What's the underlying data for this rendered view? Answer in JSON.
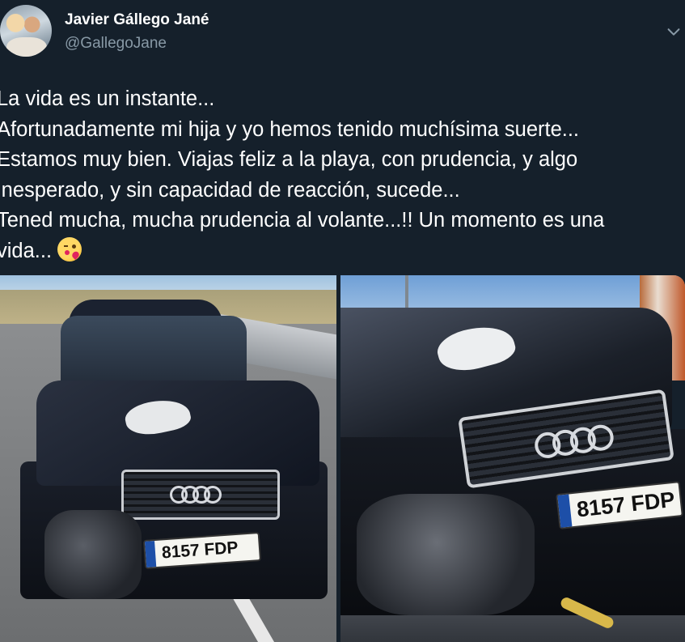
{
  "author": {
    "display_name": "Javier Gállego Jané",
    "handle": "@GallegoJane",
    "avatar_icon": "profile-photo"
  },
  "menu": {
    "icon": "chevron-down-icon"
  },
  "tweet": {
    "lines": [
      "La vida es un instante...",
      "Afortunadamente mi hija y yo hemos tenido muchísima suerte...",
      "Estamos muy bien. Viajas feliz a la playa, con prudencia, y algo",
      "inesperado, y sin capacidad de reacción, sucede...",
      "Tened mucha, mucha prudencia al volante...!! Un momento es una",
      "vida..."
    ],
    "emoji": "kissing-face-with-heart"
  },
  "media": {
    "left_plate": "8157 FDP",
    "right_plate": "8157 FDP"
  },
  "colors": {
    "background": "#15202b",
    "text_primary": "#ffffff",
    "text_secondary": "#8899a6"
  }
}
